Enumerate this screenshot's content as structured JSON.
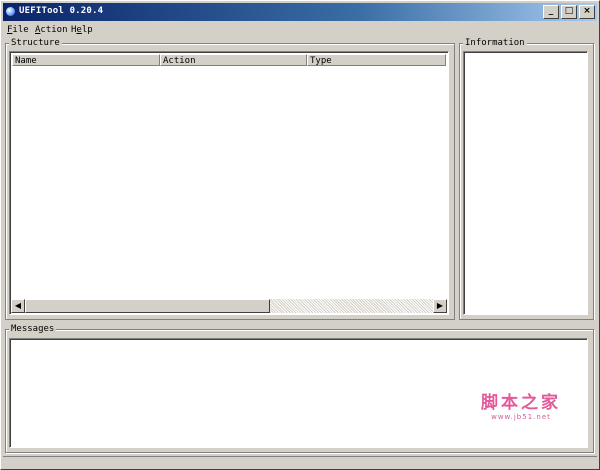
{
  "window": {
    "title": "UEFITool 0.20.4",
    "controls": {
      "minimize": "_",
      "maximize": "□",
      "close": "×"
    }
  },
  "menu": {
    "file": {
      "hotkey": "F",
      "rest": "ile"
    },
    "action": {
      "hotkey": "A",
      "rest": "ction"
    },
    "help": {
      "pre": "H",
      "hotkey": "e",
      "rest": "lp"
    }
  },
  "structure": {
    "label": "Structure",
    "columns": [
      "Name",
      "Action",
      "Type"
    ],
    "scroll_left": "◀",
    "scroll_right": "▶"
  },
  "information": {
    "label": "Information"
  },
  "messages": {
    "label": "Messages"
  },
  "watermark": {
    "text": "脚本之家",
    "url": "www.jb51.net"
  },
  "colors": {
    "titlebar_start": "#0a246a",
    "titlebar_end": "#a6caf0",
    "face": "#d4d0c8",
    "watermark": "#e35a9a"
  }
}
